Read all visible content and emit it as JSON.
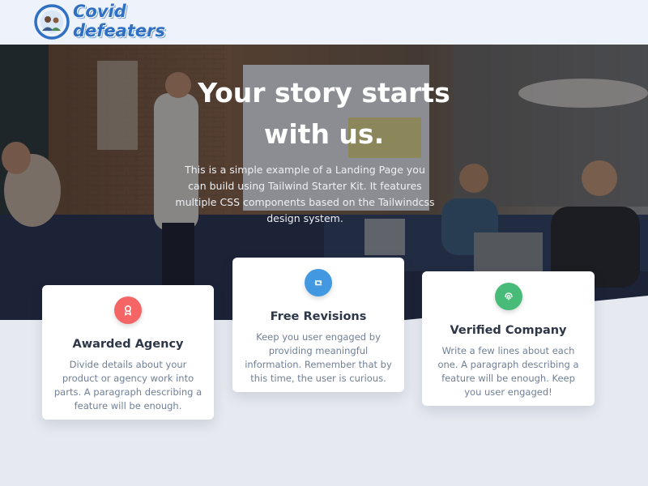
{
  "brand": {
    "line1": "Covid",
    "line2": "defeaters"
  },
  "hero": {
    "title_line1": "Your story starts",
    "title_line2": "with us.",
    "subtitle": "This is a simple example of a Landing Page you can build using Tailwind Starter Kit. It features multiple CSS components based on the Tailwindcss design system."
  },
  "features": [
    {
      "icon": "award-icon",
      "color": "#f56565",
      "title": "Awarded Agency",
      "text": "Divide details about your product or agency work into parts. A paragraph describing a feature will be enough."
    },
    {
      "icon": "retweet-icon",
      "color": "#4299e1",
      "title": "Free Revisions",
      "text": "Keep you user engaged by providing meaningful information. Remember that by this time, the user is curious."
    },
    {
      "icon": "fingerprint-icon",
      "color": "#48bb78",
      "title": "Verified Company",
      "text": "Write a few lines about each one. A paragraph describing a feature will be enough. Keep you user engaged!"
    }
  ]
}
